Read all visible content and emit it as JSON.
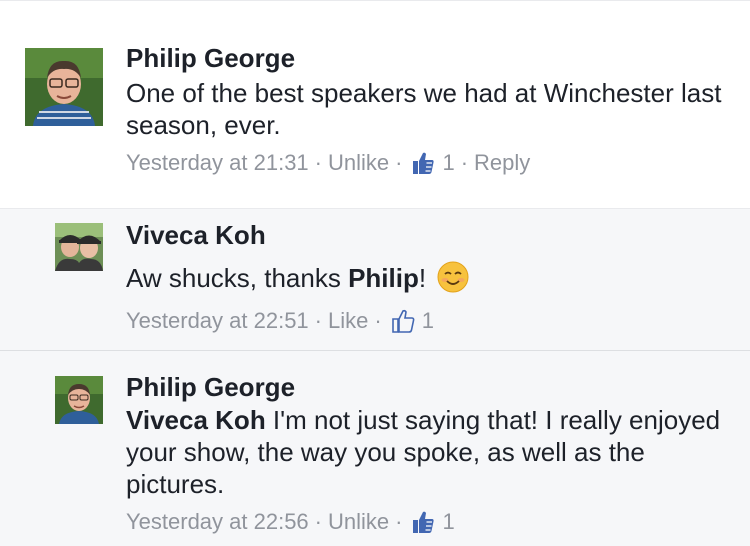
{
  "comments": [
    {
      "author": "Philip George",
      "text": "One of the best speakers we had at Winchester last season, ever.",
      "timestamp": "Yesterday at 21:31",
      "action_label": "Unlike",
      "like_count": "1",
      "reply_label": "Reply"
    },
    {
      "author": "Viveca Koh",
      "text_prefix": "Aw shucks, thanks ",
      "tagged_name": "Philip",
      "text_suffix": "!",
      "emoji": "smiling-face-emoji",
      "timestamp": "Yesterday at 22:51",
      "action_label": "Like",
      "like_count": "1"
    },
    {
      "author": "Philip George",
      "tagged_name": "Viveca Koh",
      "text": " I'm not just saying that! I really enjoyed your show, the way you spoke, as well as the pictures.",
      "timestamp": "Yesterday at 22:56",
      "action_label": "Unlike",
      "like_count": "1"
    }
  ],
  "separator": "·",
  "colors": {
    "text": "#1d2129",
    "meta": "#90949c",
    "like_blue": "#4267b2",
    "reply_background": "#f6f7f9"
  }
}
